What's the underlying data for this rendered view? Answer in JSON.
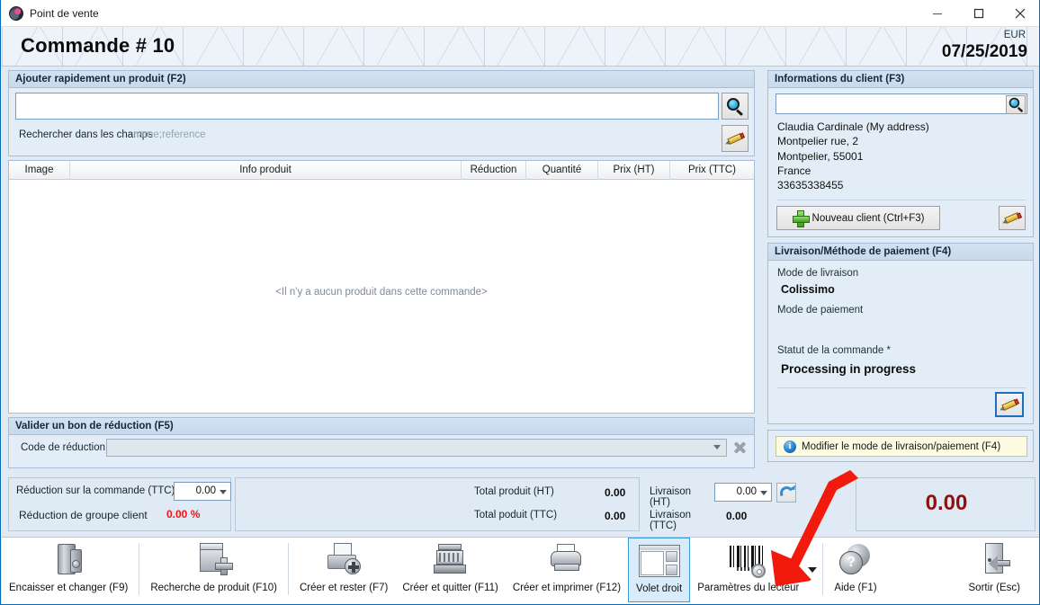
{
  "window": {
    "title": "Point de vente",
    "app_icon": "pos-globe-icon",
    "minimize": "minimize-icon",
    "maximize": "maximize-icon",
    "close": "close-icon"
  },
  "header": {
    "order_title": "Commande # 10",
    "currency": "EUR",
    "date": "07/25/2019"
  },
  "quick_add": {
    "caption": "Ajouter rapidement un produit (F2)",
    "search_value": "",
    "search_placeholder": "",
    "search_icon": "magnifier-icon",
    "edit_icon": "pencil-icon",
    "fields_label": "Rechercher dans les champs",
    "fields_value": "name;reference"
  },
  "product_table": {
    "columns": [
      "Image",
      "Info produit",
      "Réduction",
      "Quantité",
      "Prix (HT)",
      "Prix (TTC)"
    ],
    "rows": [],
    "empty_message": "<Il n'y a aucun produit dans cette commande>"
  },
  "voucher": {
    "caption": "Valider un bon de réduction (F5)",
    "label": "Code de réduction",
    "value": "",
    "clear_icon": "clear-x-icon"
  },
  "client": {
    "caption": "Informations du client (F3)",
    "search_value": "",
    "search_icon": "magnifier-icon",
    "address_lines": [
      "Claudia Cardinale (My address)",
      "Montpelier rue, 2",
      "Montpelier,  55001",
      "France",
      "33635338455"
    ],
    "new_client_label": "Nouveau client (Ctrl+F3)",
    "new_client_icon": "green-plus-icon",
    "edit_icon": "pencil-icon"
  },
  "shipping": {
    "caption": "Livraison/Méthode de paiement (F4)",
    "delivery_label": "Mode de livraison",
    "delivery_value": "Colissimo",
    "payment_label": "Mode de paiement",
    "payment_value": "",
    "status_label": "Statut de la commande *",
    "status_value": "Processing in progress",
    "edit_icon": "pencil-icon"
  },
  "hint": {
    "icon": "info-icon",
    "text": "Modifier le mode de livraison/paiement (F4)"
  },
  "totals": {
    "order_discount_label": "Réduction sur la commande (TTC)",
    "order_discount_value": "0.00",
    "group_discount_label": "Réduction de groupe client",
    "group_discount_value": "0.00 %",
    "product_ht_label": "Total produit (HT)",
    "product_ht_value": "0.00",
    "product_ttc_label": "Total poduit (TTC)",
    "product_ttc_value": "0.00",
    "shipping_ht_label": "Livraison (HT)",
    "shipping_ht_value": "0.00",
    "shipping_ttc_label": "Livraison (TTC)",
    "shipping_ttc_value": "0.00",
    "grand_total": "0.00",
    "refresh_icon": "refresh-icon"
  },
  "toolbar": {
    "items": [
      {
        "label": "Encaisser et changer (F9)",
        "icon": "cash-drawer-icon",
        "accel": "",
        "active": false
      },
      {
        "label": "Recherche de produit (F10)",
        "icon": "product-bag-icon",
        "accel": "R",
        "active": false
      },
      {
        "label": "Créer et rester (F7)",
        "icon": "save-disk-icon",
        "accel": "e",
        "active": false
      },
      {
        "label": "Créer et quitter (F11)",
        "icon": "cash-register-icon",
        "accel": "e",
        "active": false
      },
      {
        "label": "Créer et imprimer (F12)",
        "icon": "printer-icon",
        "accel": "i",
        "active": false
      },
      {
        "label": "Volet droit",
        "icon": "right-panel-icon",
        "accel": "",
        "active": true
      },
      {
        "label": "Paramètres du lecteur",
        "icon": "barcode-settings-icon",
        "accel": "",
        "active": false
      },
      {
        "label": "Aide (F1)",
        "icon": "help-icon",
        "accel": "A",
        "active": false
      },
      {
        "label": "Sortir (Esc)",
        "icon": "exit-door-icon",
        "accel": "",
        "active": false
      }
    ],
    "dropdown_icon": "caret-down-icon"
  },
  "annotation": {
    "arrow_color": "#f21a0d",
    "points_at": "barcode-settings-icon"
  }
}
